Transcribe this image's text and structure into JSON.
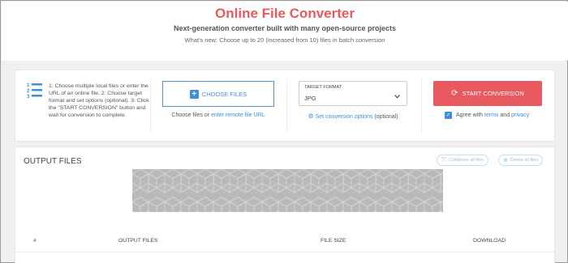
{
  "header": {
    "title": "Online File Converter",
    "subtitle": "Next-generation converter built with many open-source projects",
    "whats_new": "What's new: Choose up to 20 (increased from 10) files in batch conversion"
  },
  "steps": {
    "text": "1: Choose multiple local files or enter the URL of an online file. 2: Choose target format and set options (optional). 3: Click the \"START CONVERSION\" button and wait for conversion to complete."
  },
  "choose": {
    "button_label": "CHOOSE FILES",
    "sub_prefix": "Choose files or",
    "sub_link": "enter remote file URL"
  },
  "format": {
    "label": "TARGET FORMAT:",
    "value": "JPG",
    "options_link": "Set conversion options",
    "options_suffix": "(optional)"
  },
  "start": {
    "button_label": "START CONVERSION",
    "agree_prefix": "Agree with",
    "terms": "terms",
    "and": "and",
    "privacy": "privacy",
    "checked": true
  },
  "output": {
    "title": "OUTPUT FILES",
    "compress_label": "Compress all files",
    "delete_label": "Delete all files",
    "columns": [
      "#",
      "OUTPUT FILES",
      "FILE SIZE",
      "DOWNLOAD"
    ]
  },
  "colors": {
    "brand": "#e8585f",
    "link": "#3d8fd8",
    "pattern": "#b9b9b9"
  },
  "icons": {
    "steps": "numbered-list-icon",
    "choose": "plus-icon",
    "options": "gear-icon",
    "start": "refresh-icon",
    "agree": "checkbox-icon",
    "compress": "compress-icon",
    "delete": "close-icon"
  }
}
